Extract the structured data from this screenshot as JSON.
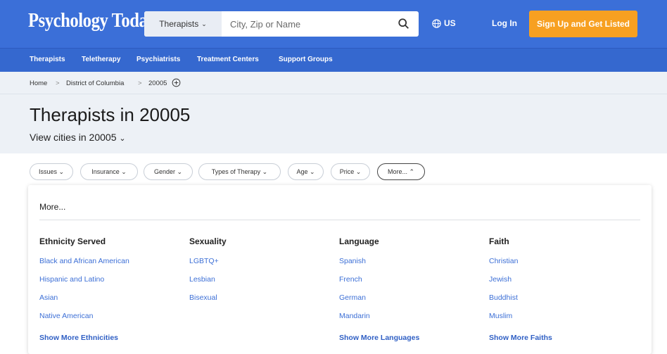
{
  "header": {
    "logo": "Psychology Today",
    "search_select": "Therapists",
    "search_placeholder": "City, Zip or Name",
    "region": "US",
    "login": "Log In",
    "signup": "Sign Up and Get Listed"
  },
  "nav": [
    "Therapists",
    "Teletherapy",
    "Psychiatrists",
    "Treatment Centers",
    "Support Groups"
  ],
  "breadcrumb": {
    "home": "Home",
    "state": "District of Columbia",
    "zip": "20005"
  },
  "page": {
    "title": "Therapists in 20005",
    "cities_link": "View cities in 20005"
  },
  "filters": [
    "Issues",
    "Insurance",
    "Gender",
    "Types of Therapy",
    "Age",
    "Price",
    "More..."
  ],
  "more_panel": {
    "title": "More...",
    "columns": [
      {
        "heading": "Ethnicity Served",
        "options": [
          "Black and African American",
          "Hispanic and Latino",
          "Asian",
          "Native American"
        ],
        "show_more": "Show More Ethnicities"
      },
      {
        "heading": "Sexuality",
        "options": [
          "LGBTQ+",
          "Lesbian",
          "Bisexual"
        ],
        "show_more": ""
      },
      {
        "heading": "Language",
        "options": [
          "Spanish",
          "French",
          "German",
          "Mandarin"
        ],
        "show_more": "Show More Languages"
      },
      {
        "heading": "Faith",
        "options": [
          "Christian",
          "Jewish",
          "Buddhist",
          "Muslim"
        ],
        "show_more": "Show More Faiths"
      }
    ]
  },
  "colors": {
    "header_blue": "#3b6fd8",
    "nav_blue": "#3568cf",
    "accent_orange": "#f7a021",
    "link_blue": "#3c6fd6"
  }
}
